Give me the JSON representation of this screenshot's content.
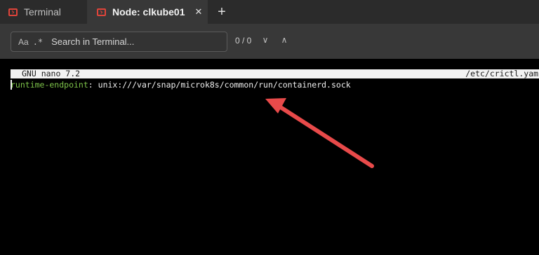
{
  "tabs": [
    {
      "label": "Terminal",
      "active": false
    },
    {
      "label": "Node: clkube01",
      "active": true
    }
  ],
  "tab_close_glyph": "✕",
  "new_tab_glyph": "+",
  "search": {
    "case_option": "Aa",
    "regex_option": ".*",
    "placeholder": "Search in Terminal...",
    "match_count": "0 / 0",
    "next_glyph": "∨",
    "prev_glyph": "∧"
  },
  "terminal": {
    "nano_version": "GNU nano 7.2",
    "file_path": "/etc/crictl.yaml",
    "key": "runtime-endpoint",
    "separator": ": ",
    "value": "unix:///var/snap/microk8s/common/run/containerd.sock"
  },
  "colors": {
    "accent_icon": "#e0443a",
    "yaml_key": "#7ec44a",
    "annotation_arrow": "#e84a4a"
  },
  "icons": {
    "tab_icon": "terminal-icon",
    "close_icon": "close-icon",
    "new_tab_icon": "plus-icon",
    "next_icon": "chevron-down-icon",
    "prev_icon": "chevron-up-icon",
    "annotation": "red-arrow-icon"
  }
}
